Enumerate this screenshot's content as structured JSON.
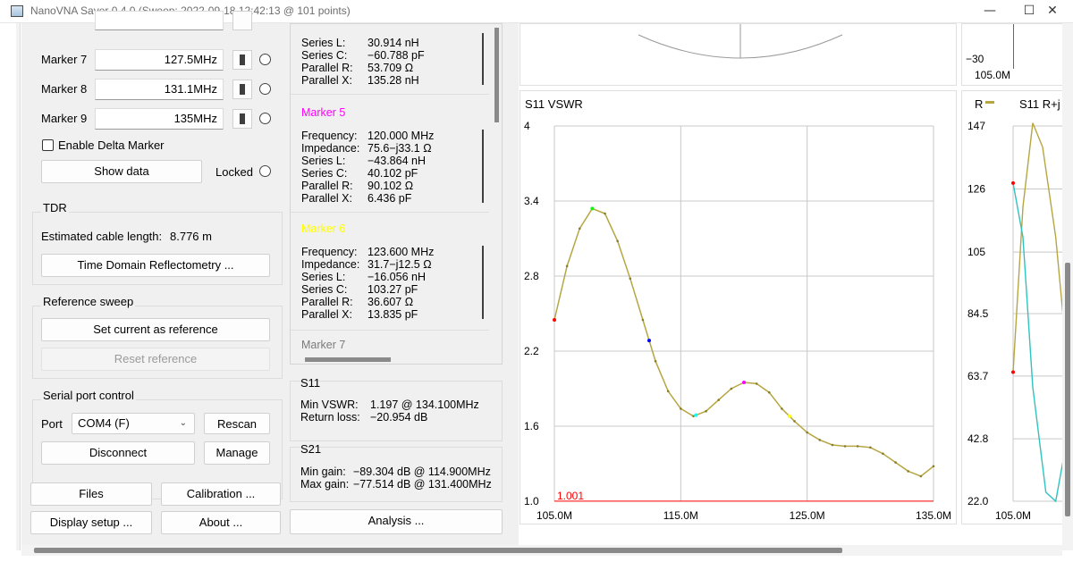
{
  "window": {
    "title": "NanoVNA Saver 0.4.0 (Sweep: 2022-09-18 12:42:13 @ 101 points)",
    "minimize_glyph": "—",
    "maximize_glyph": "☐",
    "close_glyph": "✕"
  },
  "markers": [
    {
      "label": "Marker 7",
      "frequency": "127.5MHz"
    },
    {
      "label": "Marker 8",
      "frequency": "131.1MHz"
    },
    {
      "label": "Marker 9",
      "frequency": "135MHz"
    }
  ],
  "delta_marker_label": "Enable Delta Marker",
  "show_data_label": "Show data",
  "locked_label": "Locked",
  "tdr": {
    "title": "TDR",
    "cable_label": "Estimated cable length:",
    "cable_value": "8.776 m",
    "button": "Time Domain Reflectometry ..."
  },
  "reference_sweep": {
    "title": "Reference sweep",
    "set_button": "Set current as reference",
    "reset_button": "Reset reference"
  },
  "serial": {
    "title": "Serial port control",
    "port_label": "Port",
    "port_value": "COM4 (F)",
    "rescan": "Rescan",
    "disconnect": "Disconnect",
    "manage": "Manage"
  },
  "bottom_buttons": {
    "files": "Files",
    "calibration": "Calibration ...",
    "display_setup": "Display setup ...",
    "about": "About ...",
    "analysis": "Analysis ..."
  },
  "marker_readout": {
    "keys": {
      "frequency": "Frequency:",
      "impedance": "Impedance:",
      "series_l": "Series L:",
      "series_c": "Series C:",
      "parallel_r": "Parallel R:",
      "parallel_x": "Parallel X:"
    },
    "top": {
      "series_l": "30.914 nH",
      "series_c": "−60.788 pF",
      "parallel_r": "53.709 Ω",
      "parallel_x": "135.28 nH"
    },
    "m5": {
      "title": "Marker 5",
      "color": "#ff00ff",
      "frequency": "120.000 MHz",
      "impedance": "75.6−j33.1 Ω",
      "series_l": "−43.864 nH",
      "series_c": "40.102 pF",
      "parallel_r": "90.102 Ω",
      "parallel_x": "6.436 pF"
    },
    "m6": {
      "title": "Marker 6",
      "color": "#ffff00",
      "frequency": "123.600 MHz",
      "impedance": "31.7−j12.5 Ω",
      "series_l": "−16.056 nH",
      "series_c": "103.27 pF",
      "parallel_r": "36.607 Ω",
      "parallel_x": "13.835 pF"
    },
    "m7_title": "Marker 7"
  },
  "s11_summary": {
    "title": "S11",
    "min_vswr_label": "Min VSWR:",
    "min_vswr_value": "1.197 @ 134.100MHz",
    "return_loss_label": "Return loss:",
    "return_loss_value": "−20.954 dB"
  },
  "s21_summary": {
    "title": "S21",
    "min_gain_label": "Min gain:",
    "min_gain_value": "−89.304 dB @ 114.900MHz",
    "max_gain_label": "Max gain:",
    "max_gain_value": "−77.514 dB @ 131.400MHz"
  },
  "colors": {
    "trace": "#b5a642",
    "reference_line": "#ff0000",
    "trace2": "#2fc3c0",
    "marker_red": "#ff0000",
    "marker_green": "#00ff00",
    "marker_blue": "#0000ff",
    "marker_cyan": "#00ffff",
    "marker_magenta": "#ff00ff",
    "marker_yellow": "#ffff00"
  },
  "smith_partial": {
    "ytick": "−30",
    "xtick": "105.0M"
  },
  "chart_data": [
    {
      "type": "line",
      "title": "S11 VSWR",
      "xlim": [
        105,
        135
      ],
      "ylim": [
        1.0,
        4.0
      ],
      "yticks": [
        "1.0",
        "1.6",
        "2.2",
        "2.8",
        "3.4",
        "4"
      ],
      "xticks": [
        "105.0M",
        "115.0M",
        "125.0M",
        "135.0M"
      ],
      "reference_label": "1.001",
      "grid": true,
      "x": [
        105,
        106,
        107,
        108,
        109,
        110,
        111,
        112,
        113,
        114,
        115,
        116,
        117,
        118,
        119,
        120,
        121,
        122,
        123,
        124,
        125,
        126,
        127,
        128,
        129,
        130,
        131,
        132,
        133,
        134,
        135
      ],
      "values": [
        2.45,
        2.88,
        3.18,
        3.34,
        3.3,
        3.08,
        2.78,
        2.45,
        2.12,
        1.88,
        1.74,
        1.68,
        1.72,
        1.81,
        1.9,
        1.95,
        1.94,
        1.87,
        1.74,
        1.64,
        1.55,
        1.49,
        1.45,
        1.44,
        1.44,
        1.43,
        1.38,
        1.31,
        1.24,
        1.2,
        1.28
      ],
      "markers": [
        {
          "x": 105,
          "color": "#ff0000"
        },
        {
          "x": 108,
          "color": "#00ff00"
        },
        {
          "x": 112.5,
          "color": "#0000ff"
        },
        {
          "x": 116.2,
          "color": "#00ffff"
        },
        {
          "x": 120,
          "color": "#ff00ff"
        },
        {
          "x": 123.6,
          "color": "#ffff00"
        }
      ]
    },
    {
      "type": "line",
      "title": "S11 R+j",
      "legend": "R",
      "xlim": [
        105,
        108
      ],
      "ylim": [
        22.0,
        147
      ],
      "yticks": [
        "22.0",
        "42.8",
        "63.7",
        "84.5",
        "105",
        "126",
        "147"
      ],
      "xticks": [
        "105.0M"
      ],
      "series": [
        {
          "color": "#b5a642",
          "x": [
            105,
            105.3,
            105.6,
            105.9,
            106.3,
            106.6,
            107,
            107.4,
            107.8
          ],
          "values": [
            65,
            120,
            148,
            140,
            110,
            75,
            40,
            24,
            22
          ]
        },
        {
          "color": "#2fc3c0",
          "x": [
            105,
            105.3,
            105.6,
            106,
            106.3,
            106.6,
            107,
            107.4,
            107.8
          ],
          "values": [
            128,
            110,
            60,
            25,
            22,
            40,
            65,
            84,
            100
          ]
        }
      ]
    }
  ]
}
